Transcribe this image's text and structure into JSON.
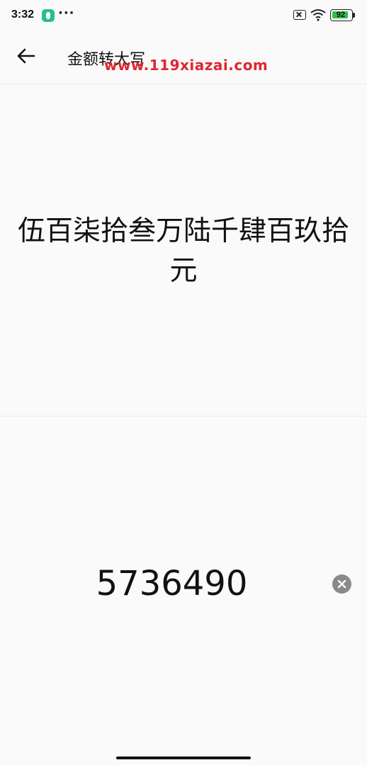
{
  "status_bar": {
    "time": "3:32",
    "more": "···",
    "battery_level": "92",
    "battery_fraction": 0.92
  },
  "app_bar": {
    "title": "金额转大写",
    "watermark": "www.119xiazai.com"
  },
  "result": {
    "text": "伍百柒拾叁万陆千肆百玖拾元"
  },
  "input": {
    "value": "5736490"
  },
  "icons": {
    "back": "arrow-left-icon",
    "clear": "clear-circle-icon",
    "wifi": "wifi-icon",
    "sim": "no-sim-icon",
    "battery": "battery-icon",
    "app": "app-notification-icon"
  },
  "colors": {
    "watermark": "#e0262f",
    "battery_fill": "#2fbf4b",
    "background": "#fafafa"
  }
}
